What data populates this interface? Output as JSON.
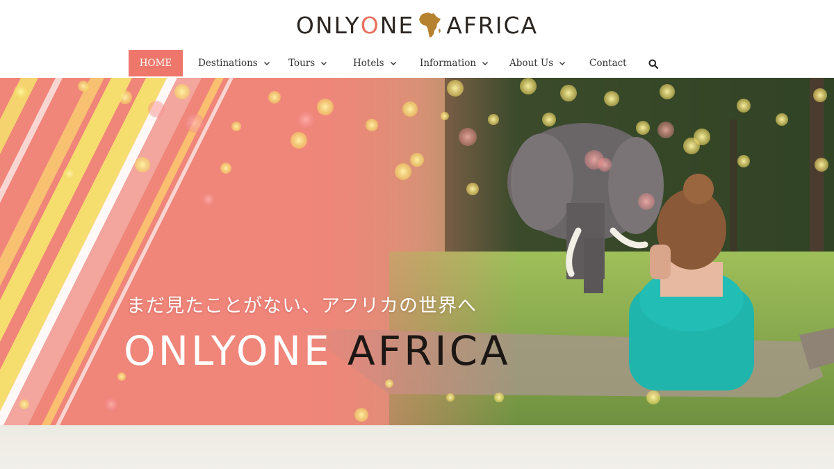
{
  "brand": {
    "logo_part1": "ONLY",
    "logo_o": "O",
    "logo_part2": "NE",
    "logo_part3": "AFRICA",
    "accent_color": "#ee766a"
  },
  "nav": {
    "items": [
      {
        "label": "HOME",
        "active": true
      },
      {
        "label": "Destinations",
        "dropdown": true
      },
      {
        "label": "Tours",
        "dropdown": true
      },
      {
        "label": "Hotels",
        "dropdown": true
      },
      {
        "label": "Information",
        "dropdown": true
      },
      {
        "label": "About Us",
        "dropdown": true
      },
      {
        "label": "Contact",
        "dropdown": false
      }
    ],
    "search_icon": "search-icon"
  },
  "hero": {
    "tagline": "まだ見たことがない、アフリカの世界へ",
    "title_part1": "ONLYONE",
    "title_part2": "AFRICA"
  }
}
